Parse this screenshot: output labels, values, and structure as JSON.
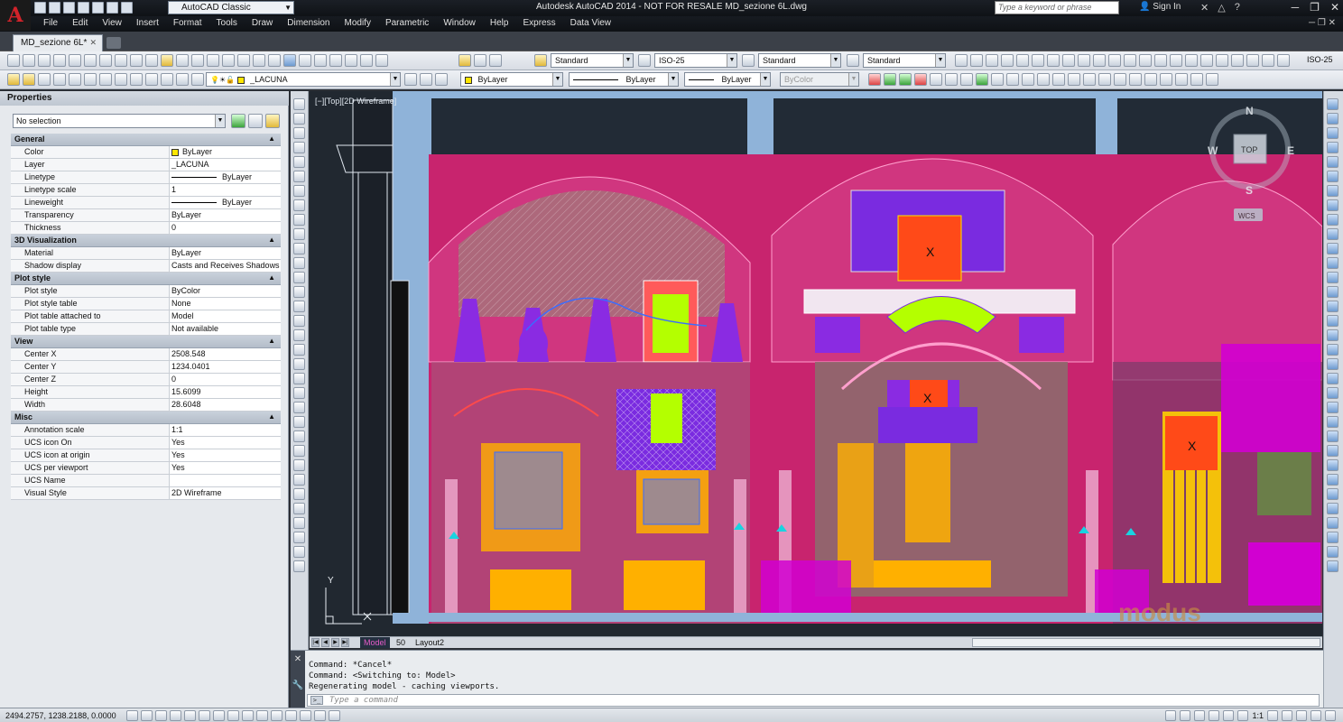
{
  "app": {
    "title": "Autodesk AutoCAD 2014 - NOT FOR RESALE   MD_sezione 6L.dwg",
    "workspace": "AutoCAD Classic",
    "search_placeholder": "Type a keyword or phrase",
    "sign_in": "Sign In"
  },
  "menu": [
    "File",
    "Edit",
    "View",
    "Insert",
    "Format",
    "Tools",
    "Draw",
    "Dimension",
    "Modify",
    "Parametric",
    "Window",
    "Help",
    "Express",
    "Data View"
  ],
  "doc_tab": {
    "label": "MD_sezione 6L*"
  },
  "styles_toolbar": {
    "text_style": "Standard",
    "dim_style": "ISO-25",
    "table_style": "Standard",
    "mleader_style": "Standard",
    "right_dim_style": "ISO-25"
  },
  "layers_toolbar": {
    "current_layer": "_LACUNA",
    "layer_color": "#ffe600",
    "color": "ByLayer",
    "linetype": "ByLayer",
    "lineweight": "ByLayer",
    "plotstyle": "ByColor"
  },
  "properties": {
    "title": "Properties",
    "selection": "No selection",
    "sections": [
      {
        "name": "General",
        "rows": [
          {
            "k": "Color",
            "v": "ByLayer"
          },
          {
            "k": "Layer",
            "v": "_LACUNA"
          },
          {
            "k": "Linetype",
            "v": "ByLayer"
          },
          {
            "k": "Linetype scale",
            "v": "1"
          },
          {
            "k": "Lineweight",
            "v": "ByLayer"
          },
          {
            "k": "Transparency",
            "v": "ByLayer"
          },
          {
            "k": "Thickness",
            "v": "0"
          }
        ]
      },
      {
        "name": "3D Visualization",
        "rows": [
          {
            "k": "Material",
            "v": "ByLayer"
          },
          {
            "k": "Shadow display",
            "v": "Casts and Receives Shadows"
          }
        ]
      },
      {
        "name": "Plot style",
        "rows": [
          {
            "k": "Plot style",
            "v": "ByColor"
          },
          {
            "k": "Plot style table",
            "v": "None"
          },
          {
            "k": "Plot table attached to",
            "v": "Model"
          },
          {
            "k": "Plot table type",
            "v": "Not available"
          }
        ]
      },
      {
        "name": "View",
        "rows": [
          {
            "k": "Center X",
            "v": "2508.548"
          },
          {
            "k": "Center Y",
            "v": "1234.0401"
          },
          {
            "k": "Center Z",
            "v": "0"
          },
          {
            "k": "Height",
            "v": "15.6099"
          },
          {
            "k": "Width",
            "v": "28.6048"
          }
        ]
      },
      {
        "name": "Misc",
        "rows": [
          {
            "k": "Annotation scale",
            "v": "1:1"
          },
          {
            "k": "UCS icon On",
            "v": "Yes"
          },
          {
            "k": "UCS icon at origin",
            "v": "Yes"
          },
          {
            "k": "UCS per viewport",
            "v": "Yes"
          },
          {
            "k": "UCS Name",
            "v": ""
          },
          {
            "k": "Visual Style",
            "v": "2D Wireframe"
          }
        ]
      }
    ]
  },
  "viewport": {
    "label": "[−][Top][2D Wireframe]",
    "viewcube": {
      "n": "N",
      "s": "S",
      "e": "E",
      "w": "W",
      "top": "TOP",
      "wcs": "WCS"
    },
    "ucs": {
      "y": "Y"
    },
    "markers": [
      "X",
      "X",
      "X"
    ],
    "watermark": "modus"
  },
  "layout_tabs": {
    "model": "Model",
    "layout1": "50",
    "layout2": "Layout2"
  },
  "command": {
    "history": [
      "Command: *Cancel*",
      "Command:   <Switching to: Model>",
      "Regenerating model - caching viewports."
    ],
    "placeholder": "Type a command"
  },
  "status": {
    "coords": "2494.2757, 1238.2188, 0.0000",
    "annotation_scale": "1:1"
  },
  "colors": {
    "magenta": "#e0287a",
    "violet": "#8a2be2",
    "orange": "#ffb000",
    "lime": "#b4ff00",
    "red": "#ff4a18",
    "sky": "#8fb3d9",
    "dark": "#212830"
  }
}
